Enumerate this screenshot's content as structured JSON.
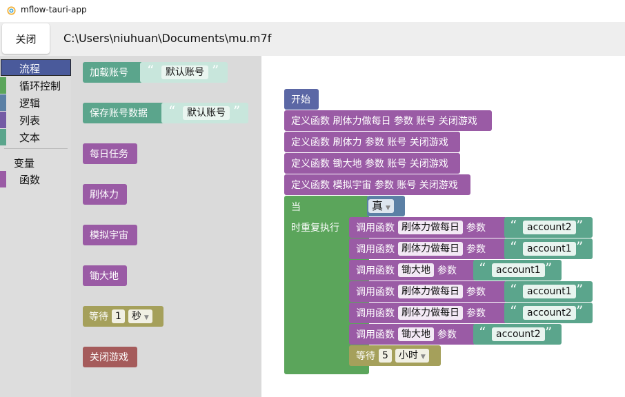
{
  "window": {
    "title": "mflow-tauri-app",
    "icon": "app-logo-icon"
  },
  "header": {
    "close_label": "关闭",
    "file_path": "C:\\Users\\niuhuan\\Documents\\mu.m7f"
  },
  "toolbox": {
    "categories": [
      {
        "label": "流程",
        "color": "#5b67a5",
        "selected": true
      },
      {
        "label": "循环控制",
        "color": "#5ba55b"
      },
      {
        "label": "逻辑",
        "color": "#5b80a5"
      },
      {
        "label": "列表",
        "color": "#745ba5"
      },
      {
        "label": "文本",
        "color": "#5ba58c"
      }
    ],
    "variables_label": "变量",
    "functions": {
      "label": "函数",
      "color": "#9a5ba5"
    }
  },
  "flyout": {
    "load_account": {
      "label": "加载账号",
      "value": "默认账号"
    },
    "save_account": {
      "label": "保存账号数据",
      "value": "默认账号"
    },
    "daily_tasks": "每日任务",
    "stamina": "刷体力",
    "sim_universe": "模拟宇宙",
    "hoe_land": "锄大地",
    "wait": {
      "label": "等待",
      "amount": "1",
      "unit": "秒"
    },
    "close_game": "关闭游戏"
  },
  "workspace": {
    "start_label": "开始",
    "definitions": [
      "定义函数 刷体力做每日 参数 账号 关闭游戏",
      "定义函数 刷体力 参数 账号 关闭游戏",
      "定义函数 锄大地 参数 账号 关闭游戏",
      "定义函数 模拟宇宙 参数 账号 关闭游戏"
    ],
    "while_label_1": "当",
    "while_label_2": "时重复执行",
    "condition_value": "真",
    "call_prefix": "调用函数",
    "params_label": "参数",
    "calls": [
      {
        "func": "刷体力做每日",
        "arg": "account2"
      },
      {
        "func": "刷体力做每日",
        "arg": "account1"
      },
      {
        "func": "锄大地",
        "arg": "account1"
      },
      {
        "func": "刷体力做每日",
        "arg": "account1"
      },
      {
        "func": "刷体力做每日",
        "arg": "account2"
      },
      {
        "func": "锄大地",
        "arg": "account2"
      }
    ],
    "wait": {
      "label": "等待",
      "amount": "5",
      "unit": "小时"
    }
  },
  "colors": {
    "procedure": "#9a5ba5",
    "text": "#5ba58c",
    "loop": "#5ba55b",
    "flow": "#5b67a5",
    "wait": "#a5a05b",
    "close": "#a55b5b"
  }
}
